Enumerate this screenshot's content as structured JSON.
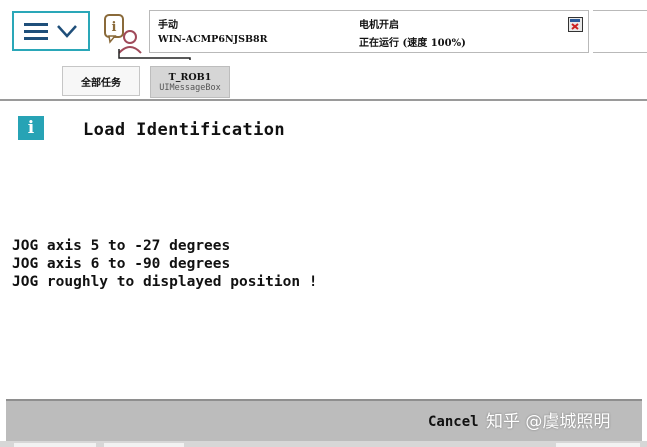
{
  "status": {
    "mode": "手动",
    "hostname": "WIN-ACMP6NJSB8R",
    "motor": "电机开启",
    "running": "正在运行 (速度 100%)"
  },
  "tabs": {
    "all_tasks": "全部任务",
    "active_title": "T_ROB1",
    "active_subtitle": "UIMessageBox"
  },
  "message": {
    "icon": "i",
    "title": "Load Identification",
    "lines": [
      "JOG axis 5 to -27 degrees",
      "JOG axis 6 to -90 degrees",
      "JOG roughly to displayed position !"
    ]
  },
  "buttons": {
    "cancel": "Cancel"
  },
  "watermark": "知乎 @虞城照明",
  "icons": {
    "menu": "hamburger-icon",
    "menu_chevron": "chevron-down-icon",
    "event_log": "event-log-icon",
    "close": "close-icon",
    "info": "info-icon"
  },
  "colors": {
    "accent": "#27a3b5",
    "menu_border": "#2aa7b8",
    "bottom_bar": "#bcbcbc",
    "active_tab": "#d6d6d6"
  }
}
